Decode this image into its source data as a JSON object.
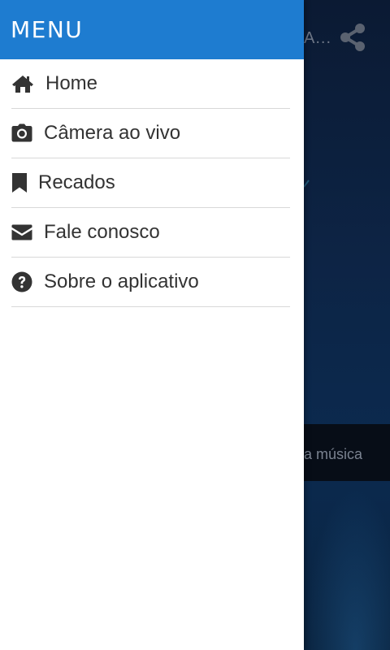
{
  "background": {
    "title": "A...",
    "player_text": "a música"
  },
  "drawer": {
    "title": "MENU",
    "items": [
      {
        "label": "Home",
        "icon": "home-icon"
      },
      {
        "label": "Câmera ao vivo",
        "icon": "camera-icon"
      },
      {
        "label": "Recados",
        "icon": "bookmark-icon"
      },
      {
        "label": "Fale conosco",
        "icon": "envelope-icon"
      },
      {
        "label": "Sobre o aplicativo",
        "icon": "question-circle-icon"
      }
    ]
  },
  "colors": {
    "drawer_header": "#1e7cd0",
    "menu_text": "#333333",
    "divider": "#d8d8d8"
  }
}
